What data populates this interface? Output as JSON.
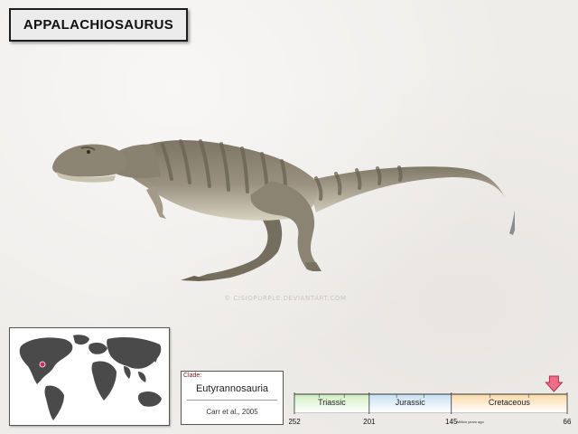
{
  "title": "APPALACHIOSAURUS",
  "watermark": "© CISIOPURPLE.DEVIANTART.COM",
  "clade": {
    "label": "Clade:",
    "name": "Eutyrannosauria",
    "citation": "Carr et al., 2005"
  },
  "timeline": {
    "periods": [
      {
        "name": "Triassic",
        "start": 252,
        "end": 201,
        "color": "#cfeec0"
      },
      {
        "name": "Jurassic",
        "start": 201,
        "end": 145,
        "color": "#c7dff0"
      },
      {
        "name": "Cretaceous",
        "start": 145,
        "end": 66,
        "color": "#fbd9a6"
      }
    ],
    "ticks": [
      "252",
      "201",
      "145",
      "66"
    ],
    "unit": "Million years ago",
    "marker_mya": 75
  },
  "map": {
    "marker_region": "eastern North America"
  },
  "colors": {
    "silhouette": "#8c8c8c",
    "map_land": "#4a4a4a",
    "marker": "#e0245e",
    "dino_body": "#8f8776",
    "dino_belly": "#d9d3c2",
    "dino_stripe": "#6e6656"
  }
}
